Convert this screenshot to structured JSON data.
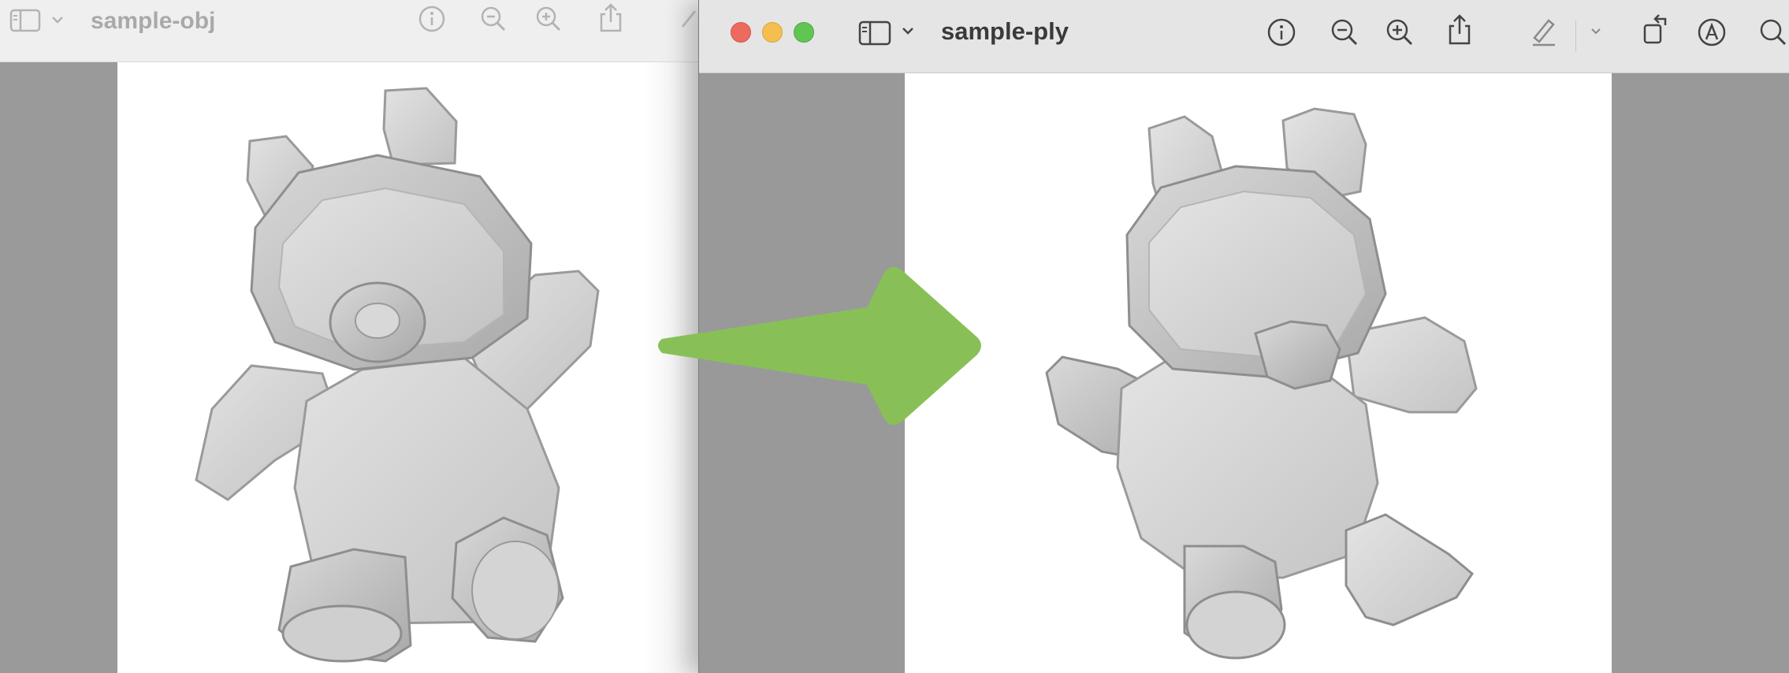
{
  "windows": {
    "back": {
      "title": "sample-obj",
      "icons": [
        "sidebar-icon",
        "chevron-down-icon",
        "info-icon",
        "zoom-out-icon",
        "zoom-in-icon",
        "share-icon",
        "highlighter-icon"
      ]
    },
    "front": {
      "title": "sample-ply",
      "icons": [
        "sidebar-icon",
        "chevron-down-icon",
        "info-icon",
        "zoom-out-icon",
        "zoom-in-icon",
        "share-icon",
        "highlighter-icon",
        "chevron-down-icon",
        "rotate-icon",
        "markup-icon",
        "search-icon"
      ]
    }
  },
  "annotation": {
    "arrow_color": "#88c057"
  },
  "colors": {
    "traffic_close": "#ed6a5e",
    "traffic_min": "#f5bf4f",
    "traffic_max": "#61c554"
  }
}
